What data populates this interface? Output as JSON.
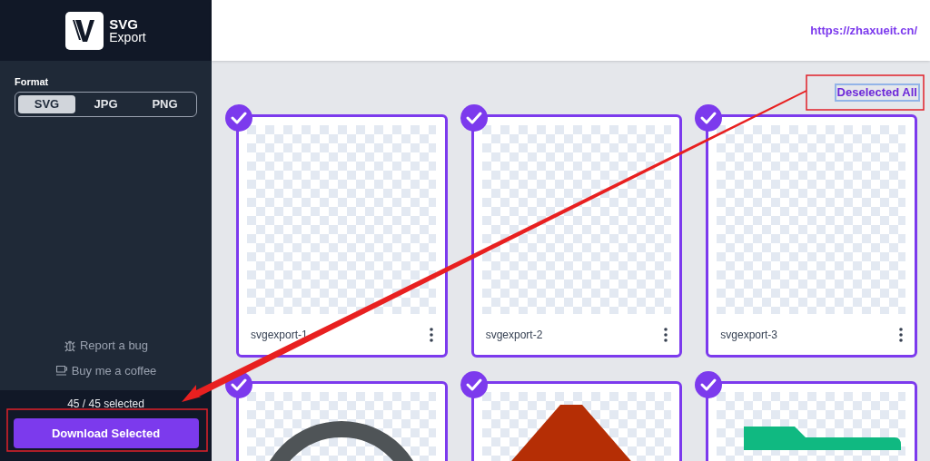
{
  "logo": {
    "title": "SVG",
    "subtitle": "Export"
  },
  "format": {
    "label": "Format",
    "options": [
      {
        "label": "SVG",
        "selected": true
      },
      {
        "label": "JPG",
        "selected": false
      },
      {
        "label": "PNG",
        "selected": false
      }
    ]
  },
  "links": [
    {
      "kind": "bug",
      "label": "Report a bug"
    },
    {
      "kind": "coffee",
      "label": "Buy me a coffee"
    }
  ],
  "selection_count": "45 / 45 selected",
  "download_button": "Download Selected",
  "site_link": "https://zhaxueit.cn/",
  "deselect_button": "Deselected All",
  "cards": [
    {
      "label": "svgexport-1",
      "selected": true,
      "kind": "empty"
    },
    {
      "label": "svgexport-2",
      "selected": true,
      "kind": "empty"
    },
    {
      "label": "svgexport-3",
      "selected": true,
      "kind": "empty"
    },
    {
      "selected": true,
      "kind": "ring"
    },
    {
      "selected": true,
      "kind": "trapezoid"
    },
    {
      "selected": true,
      "kind": "tab"
    }
  ]
}
